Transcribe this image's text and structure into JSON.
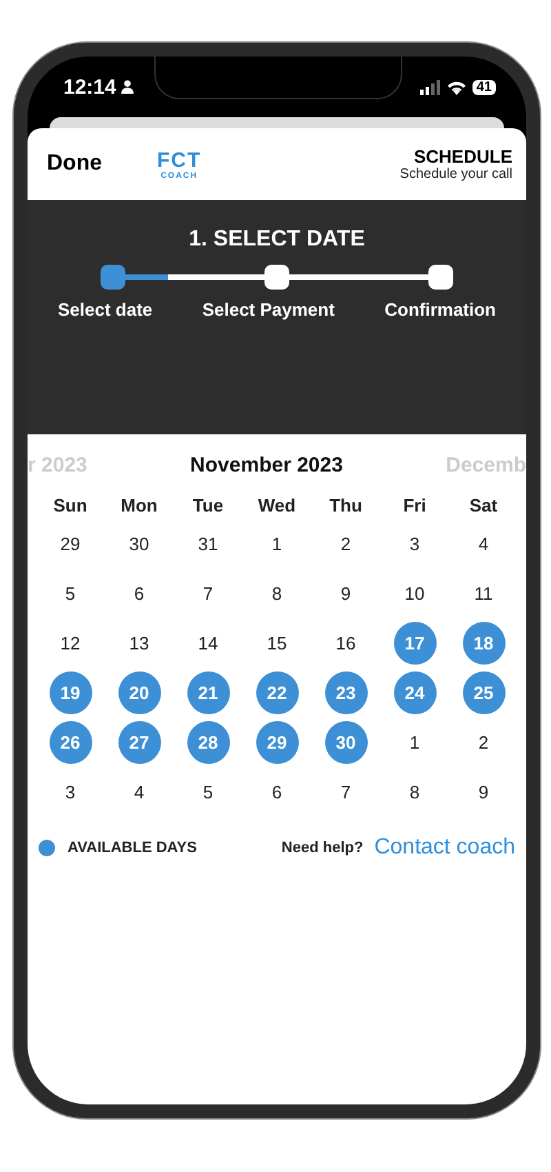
{
  "status_bar": {
    "time": "12:14",
    "battery": "41"
  },
  "header": {
    "done": "Done",
    "logo_main": "FCT",
    "logo_sub": "COACH",
    "title": "SCHEDULE",
    "subtitle": "Schedule your call"
  },
  "stepper": {
    "heading": "1. SELECT DATE",
    "level": 0.17,
    "steps": [
      {
        "label": "Select date",
        "selected": true
      },
      {
        "label": "Select Payment",
        "selected": false
      },
      {
        "label": "Confirmation",
        "selected": false
      }
    ]
  },
  "calendar": {
    "prev_month": "r 2023",
    "month": "November 2023",
    "next_month": "Decemb",
    "weekdays": [
      "Sun",
      "Mon",
      "Tue",
      "Wed",
      "Thu",
      "Fri",
      "Sat"
    ],
    "weeks": [
      [
        {
          "day": "29",
          "available": false
        },
        {
          "day": "30",
          "available": false
        },
        {
          "day": "31",
          "available": false
        },
        {
          "day": "1",
          "available": false
        },
        {
          "day": "2",
          "available": false
        },
        {
          "day": "3",
          "available": false
        },
        {
          "day": "4",
          "available": false
        }
      ],
      [
        {
          "day": "5",
          "available": false
        },
        {
          "day": "6",
          "available": false
        },
        {
          "day": "7",
          "available": false
        },
        {
          "day": "8",
          "available": false
        },
        {
          "day": "9",
          "available": false
        },
        {
          "day": "10",
          "available": false
        },
        {
          "day": "11",
          "available": false
        }
      ],
      [
        {
          "day": "12",
          "available": false
        },
        {
          "day": "13",
          "available": false
        },
        {
          "day": "14",
          "available": false
        },
        {
          "day": "15",
          "available": false
        },
        {
          "day": "16",
          "available": false
        },
        {
          "day": "17",
          "available": true
        },
        {
          "day": "18",
          "available": true
        }
      ],
      [
        {
          "day": "19",
          "available": true
        },
        {
          "day": "20",
          "available": true
        },
        {
          "day": "21",
          "available": true
        },
        {
          "day": "22",
          "available": true
        },
        {
          "day": "23",
          "available": true
        },
        {
          "day": "24",
          "available": true
        },
        {
          "day": "25",
          "available": true
        }
      ],
      [
        {
          "day": "26",
          "available": true
        },
        {
          "day": "27",
          "available": true
        },
        {
          "day": "28",
          "available": true
        },
        {
          "day": "29",
          "available": true
        },
        {
          "day": "30",
          "available": true
        },
        {
          "day": "1",
          "available": false
        },
        {
          "day": "2",
          "available": false
        }
      ],
      [
        {
          "day": "3",
          "available": false
        },
        {
          "day": "4",
          "available": false
        },
        {
          "day": "5",
          "available": false
        },
        {
          "day": "6",
          "available": false
        },
        {
          "day": "7",
          "available": false
        },
        {
          "day": "8",
          "available": false
        },
        {
          "day": "9",
          "available": false
        }
      ]
    ]
  },
  "legend": {
    "label": "AVAILABLE DAYS",
    "help": "Need help?",
    "link": "Contact coach"
  }
}
